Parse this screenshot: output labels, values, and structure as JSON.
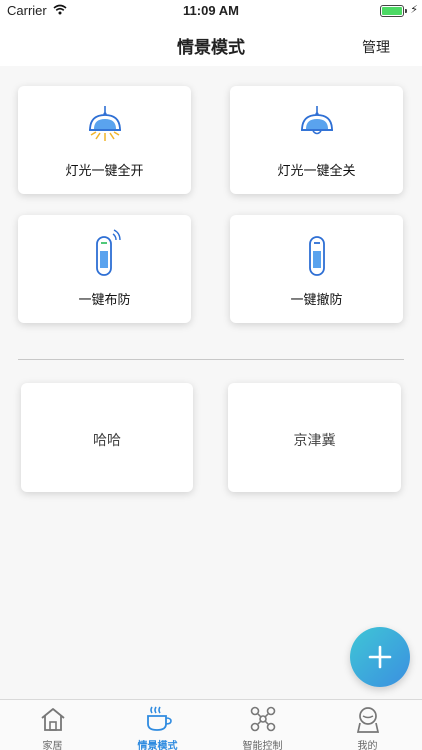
{
  "status_bar": {
    "carrier": "Carrier",
    "time": "11:09 AM"
  },
  "header": {
    "title": "情景模式",
    "manage_label": "管理"
  },
  "scenes": [
    {
      "label": "灯光一键全开",
      "icon": "lamp-on-icon"
    },
    {
      "label": "灯光一键全关",
      "icon": "lamp-off-icon"
    },
    {
      "label": "一键布防",
      "icon": "sensor-arm-icon"
    },
    {
      "label": "一键撤防",
      "icon": "sensor-disarm-icon"
    }
  ],
  "custom_scenes": [
    {
      "label": "哈哈"
    },
    {
      "label": "京津冀"
    }
  ],
  "tabbar": [
    {
      "label": "家居",
      "icon": "home-icon",
      "active": false
    },
    {
      "label": "情景模式",
      "icon": "coffee-cup-icon",
      "active": true
    },
    {
      "label": "智能控制",
      "icon": "network-icon",
      "active": false
    },
    {
      "label": "我的",
      "icon": "user-icon",
      "active": false
    }
  ],
  "colors": {
    "accent": "#2f8be0",
    "icon_blue": "#2e6fd4",
    "glow": "#f0b429",
    "fab_start": "#3fc6d6",
    "fab_end": "#3b8fe0"
  }
}
